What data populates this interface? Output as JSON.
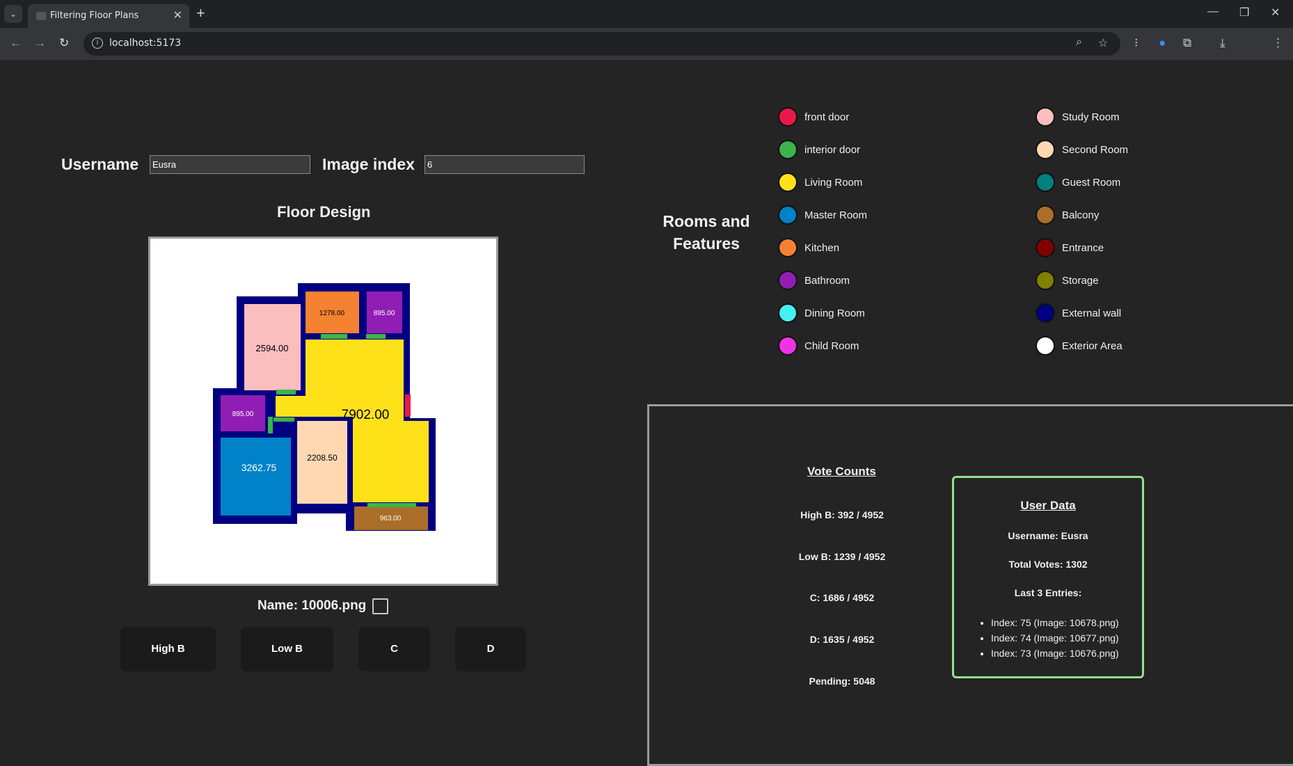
{
  "browser": {
    "tab_title": "Filtering Floor Plans",
    "url": "localhost:5173"
  },
  "form": {
    "username_label": "Username",
    "username_value": "Eusra",
    "image_index_label": "Image index",
    "image_index_value": "6"
  },
  "floor": {
    "title": "Floor Design",
    "name_label": "Name: 10006.png",
    "room_areas": [
      "2594.00",
      "1278.00",
      "895.00",
      "7902.00",
      "895.00",
      "3262.75",
      "2208.50",
      "963.00"
    ]
  },
  "vote_buttons": [
    "High B",
    "Low B",
    "C",
    "D"
  ],
  "legend": {
    "title": "Rooms and Features",
    "items": [
      {
        "label": "front door",
        "color": "#e8194a"
      },
      {
        "label": "interior door",
        "color": "#3cb44b"
      },
      {
        "label": "Living Room",
        "color": "#ffe119"
      },
      {
        "label": "Master Room",
        "color": "#0082c8"
      },
      {
        "label": "Kitchen",
        "color": "#f58231"
      },
      {
        "label": "Bathroom",
        "color": "#911eb4"
      },
      {
        "label": "Dining Room",
        "color": "#46f0f0"
      },
      {
        "label": "Child Room",
        "color": "#f032e6"
      },
      {
        "label": "Study Room",
        "color": "#fabebe"
      },
      {
        "label": "Second Room",
        "color": "#ffd8b1"
      },
      {
        "label": "Guest Room",
        "color": "#008080"
      },
      {
        "label": "Balcony",
        "color": "#aa6e28"
      },
      {
        "label": "Entrance",
        "color": "#800000"
      },
      {
        "label": "Storage",
        "color": "#808000"
      },
      {
        "label": "External wall",
        "color": "#000080"
      },
      {
        "label": "Exterior Area",
        "color": "#ffffff"
      }
    ]
  },
  "vote_counts": {
    "title": "Vote Counts",
    "high_b": "High B: 392 / 4952",
    "low_b": "Low B: 1239 / 4952",
    "c": "C: 1686 / 4952",
    "d": "D: 1635 / 4952",
    "pending": "Pending: 5048"
  },
  "user_data": {
    "title": "User Data",
    "username": "Username: Eusra",
    "total_votes": "Total Votes: 1302",
    "last_entries_label": "Last 3 Entries:",
    "entries": [
      "Index: 75 (Image: 10678.png)",
      "Index: 74 (Image: 10677.png)",
      "Index: 73 (Image: 10676.png)"
    ]
  }
}
